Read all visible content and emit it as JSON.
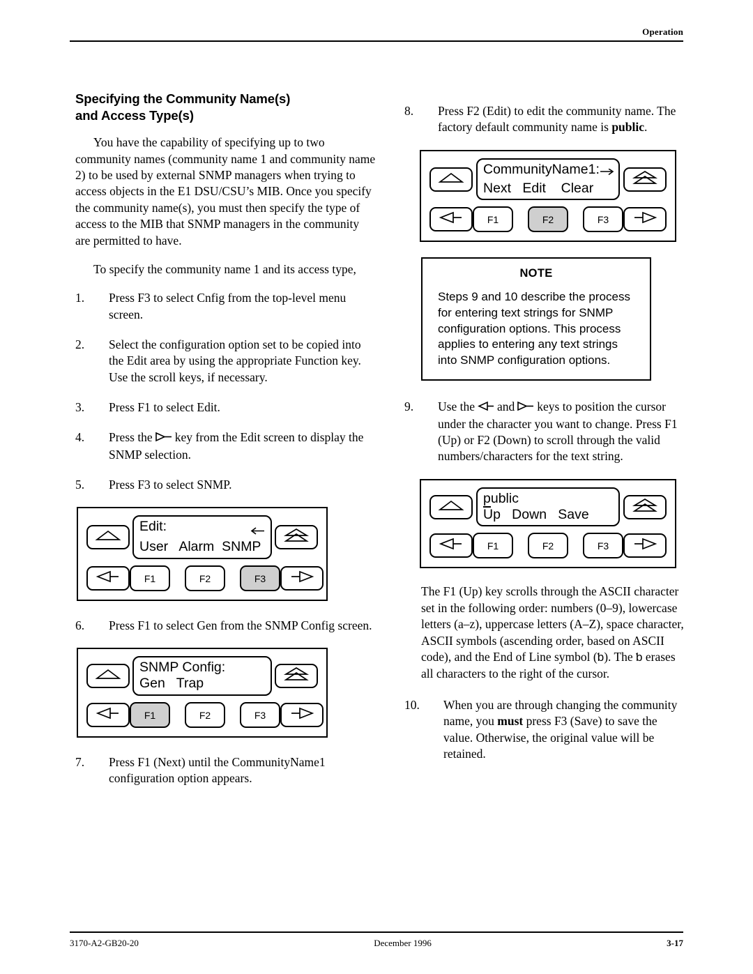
{
  "header": {
    "running_head": "Operation"
  },
  "footer": {
    "doc_number": "3170-A2-GB20-20",
    "date": "December 1996",
    "page_number": "3-17"
  },
  "left_column": {
    "section_title_line1": "Specifying the Community Name(s)",
    "section_title_line2": "and Access Type(s)",
    "intro_paragraph": "You have the capability of specifying up to two community names (community name 1 and community name 2) to be used by external SNMP managers when trying to access objects in the E1 DSU/CSU’s MIB. Once you specify the community name(s), you must then specify the type of access to the MIB that SNMP managers in the community are permitted to have.",
    "lead_in": "To specify the community name 1 and its access type,",
    "steps": [
      {
        "num": "1.",
        "text": "Press F3 to select Cnfig from the top-level menu screen."
      },
      {
        "num": "2.",
        "text": "Select the configuration option set to be copied into the Edit area by using the appropriate Function key. Use the scroll keys, if necessary."
      },
      {
        "num": "3.",
        "text": "Press F1 to select Edit."
      },
      {
        "num": "4.",
        "text_before": "Press the",
        "glyph": "right-arrow-key",
        "text_after": "key from the Edit screen to display the SNMP selection."
      },
      {
        "num": "5.",
        "text": "Press F3 to select SNMP."
      },
      {
        "num": "6.",
        "text": "Press F1 to select Gen from the SNMP Config screen."
      },
      {
        "num": "7.",
        "text": "Press F1 (Next) until the CommunityName1 configuration option appears."
      }
    ],
    "panel_edit": {
      "lcd_line1": "Edit:",
      "lcd_line1_arrow": "left-arrow-bar-icon",
      "lcd_line2": "User   Alarm  SNMP",
      "nav_up": "scroll-up-icon",
      "nav_home": "double-up-icon",
      "nav_left": "left-arrow-icon",
      "nav_right": "right-arrow-icon",
      "fkeys": [
        {
          "label": "F1",
          "selected": false
        },
        {
          "label": "F2",
          "selected": false
        },
        {
          "label": "F3",
          "selected": true
        }
      ]
    },
    "panel_snmp_config": {
      "lcd_line1": "SNMP Config:",
      "lcd_line2": "Gen   Trap",
      "nav_up": "scroll-up-icon",
      "nav_home": "double-up-icon",
      "nav_left": "left-arrow-icon",
      "nav_right": "right-arrow-icon",
      "fkeys": [
        {
          "label": "F1",
          "selected": true
        },
        {
          "label": "F2",
          "selected": false
        },
        {
          "label": "F3",
          "selected": false
        }
      ]
    }
  },
  "right_column": {
    "steps": [
      {
        "num": "8.",
        "text_before": "Press F2 (Edit) to edit the community name. The factory default community name is ",
        "bold": "public",
        "text_after": "."
      },
      {
        "num": "9.",
        "text_before": "Use the",
        "glyph_left": "left-arrow-key",
        "text_mid": "and",
        "glyph_right": "right-arrow-key",
        "text_after": "keys to position the cursor under the character you want to change. Press F1 (Up) or F2 (Down) to scroll through the valid numbers/characters for the text string."
      },
      {
        "num": "10.",
        "text_before": "When you are through changing the community name, you ",
        "bold": "must",
        "text_after": " press F3 (Save) to save the value. Otherwise, the original value will be retained."
      }
    ],
    "panel_community": {
      "lcd_line1": "CommunityName1:",
      "lcd_line1_arrow": "right-arrow-bar-icon",
      "lcd_line2": "Next   Edit    Clear",
      "nav_up": "scroll-up-icon",
      "nav_home": "double-up-icon",
      "nav_left": "left-arrow-icon",
      "nav_right": "right-arrow-icon",
      "fkeys": [
        {
          "label": "F1",
          "selected": false
        },
        {
          "label": "F2",
          "selected": true
        },
        {
          "label": "F3",
          "selected": false
        }
      ]
    },
    "note": {
      "title": "NOTE",
      "body": "Steps 9 and 10 describe the process for entering text strings for SNMP configuration options. This process applies to entering any text strings into SNMP configuration options."
    },
    "panel_public": {
      "lcd_line1_cursor_char": "p",
      "lcd_line1_rest": "ublic",
      "lcd_line2": "Up   Down   Save",
      "nav_up": "scroll-up-icon",
      "nav_home": "double-up-icon",
      "nav_left": "left-arrow-icon",
      "nav_right": "right-arrow-icon",
      "fkeys": [
        {
          "label": "F1",
          "selected": false
        },
        {
          "label": "F2",
          "selected": false
        },
        {
          "label": "F3",
          "selected": false
        }
      ]
    },
    "ascii_paragraph_part1": "The F1 (Up) key scrolls through the ASCII character set in the following order: numbers (0–9), lowercase letters (a–z), uppercase letters (A–Z), space character, ASCII symbols (ascending order, based on ASCII code), and the End of Line symbol (",
    "ascii_eol_symbol": "ƅ",
    "ascii_paragraph_part2": "). The",
    "ascii_paragraph_part3": "erases all characters to the right of the cursor."
  }
}
